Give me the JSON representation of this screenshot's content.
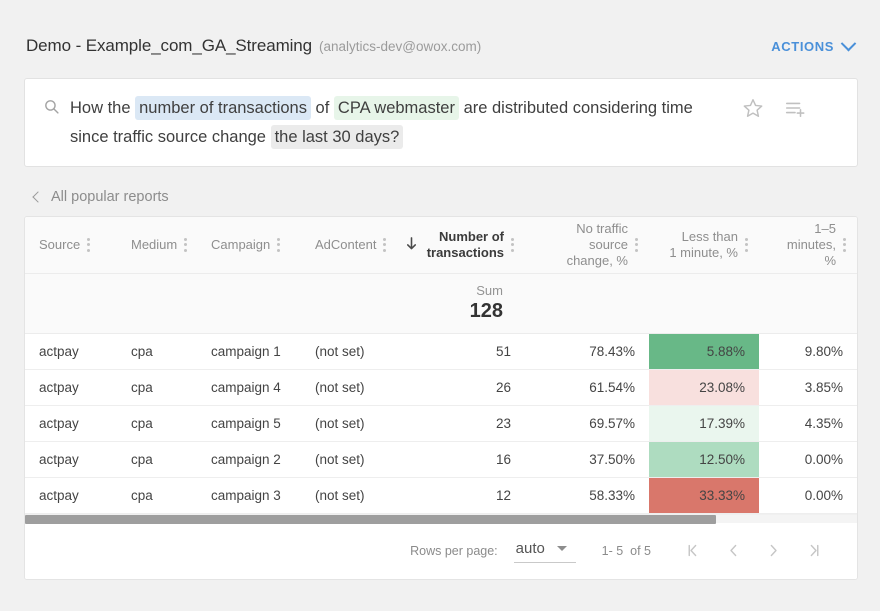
{
  "header": {
    "title": "Demo - Example_com_GA_Streaming",
    "account": "(analytics-dev@owox.com)",
    "actions_label": "ACTIONS"
  },
  "search": {
    "segments": [
      {
        "text": "How the ",
        "highlight": "none"
      },
      {
        "text": "number of transactions",
        "highlight": "blue"
      },
      {
        "text": " of ",
        "highlight": "none"
      },
      {
        "text": "CPA webmaster",
        "highlight": "green"
      },
      {
        "text": " are distributed considering time since traffic source  change ",
        "highlight": "none"
      },
      {
        "text": "the last 30 days?",
        "highlight": "gray"
      }
    ],
    "full_text": "How the number of transactions of CPA webmaster are distributed considering time since traffic source  change the last 30 days?",
    "icons": {
      "search": "search-icon",
      "favorite": "star-outline-icon",
      "add_to_list": "playlist-add-icon"
    }
  },
  "breadcrumb": {
    "label": "All popular reports"
  },
  "table": {
    "columns": [
      {
        "label": "Source",
        "align": "left",
        "sorted": false
      },
      {
        "label": "Medium",
        "align": "left",
        "sorted": false
      },
      {
        "label": "Campaign",
        "align": "left",
        "sorted": false
      },
      {
        "label": "AdContent",
        "align": "left",
        "sorted": false
      },
      {
        "label_line1": "Number of",
        "label_line2": "transactions",
        "align": "right",
        "sorted": true,
        "sort_dir": "desc"
      },
      {
        "label_line1": "No traffic source",
        "label_line2": "change, %",
        "align": "right",
        "sorted": false
      },
      {
        "label_line1": "Less than",
        "label_line2": "1 minute, %",
        "align": "right",
        "sorted": false
      },
      {
        "label_line1": "1–5",
        "label_line2": "minutes, %",
        "align": "right",
        "sorted": false
      }
    ],
    "summary": {
      "label": "Sum",
      "value": "128"
    },
    "rows": [
      {
        "source": "actpay",
        "medium": "cpa",
        "campaign": "campaign 1",
        "adcontent": "(not set)",
        "transactions": "51",
        "no_change": "78.43%",
        "less_1min": "5.88%",
        "heat_color": "#68b887",
        "min_1_5": "9.80%"
      },
      {
        "source": "actpay",
        "medium": "cpa",
        "campaign": "campaign 4",
        "adcontent": "(not set)",
        "transactions": "26",
        "no_change": "61.54%",
        "less_1min": "23.08%",
        "heat_color": "#f8e0de",
        "min_1_5": "3.85%"
      },
      {
        "source": "actpay",
        "medium": "cpa",
        "campaign": "campaign 5",
        "adcontent": "(not set)",
        "transactions": "23",
        "no_change": "69.57%",
        "less_1min": "17.39%",
        "heat_color": "#eaf6ee",
        "min_1_5": "4.35%"
      },
      {
        "source": "actpay",
        "medium": "cpa",
        "campaign": "campaign 2",
        "adcontent": "(not set)",
        "transactions": "16",
        "no_change": "37.50%",
        "less_1min": "12.50%",
        "heat_color": "#aedcc0",
        "min_1_5": "0.00%"
      },
      {
        "source": "actpay",
        "medium": "cpa",
        "campaign": "campaign 3",
        "adcontent": "(not set)",
        "transactions": "12",
        "no_change": "58.33%",
        "less_1min": "33.33%",
        "heat_color": "#d9776b",
        "min_1_5": "0.00%"
      }
    ],
    "scrollbar": {
      "thumb_percent": 83
    }
  },
  "footer": {
    "rows_per_page_label": "Rows per page:",
    "rows_per_page_value": "auto",
    "range_label": "1- 5  of 5",
    "buttons": [
      "first-page",
      "previous-page",
      "next-page",
      "last-page"
    ]
  },
  "colors": {
    "accent": "#4a90d9",
    "page_bg": "#f1f1f1",
    "card_bg": "#ffffff"
  }
}
